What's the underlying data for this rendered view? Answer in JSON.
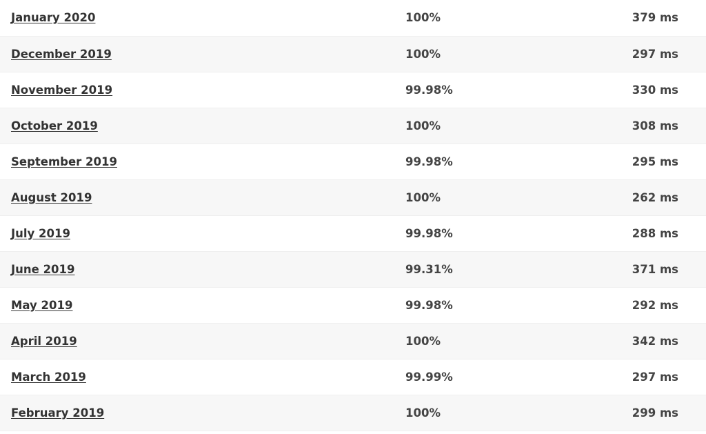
{
  "rows": [
    {
      "month": "January 2020",
      "uptime": "100%",
      "response": "379 ms"
    },
    {
      "month": "December 2019",
      "uptime": "100%",
      "response": "297 ms"
    },
    {
      "month": "November 2019",
      "uptime": "99.98%",
      "response": "330 ms"
    },
    {
      "month": "October 2019",
      "uptime": "100%",
      "response": "308 ms"
    },
    {
      "month": "September 2019",
      "uptime": "99.98%",
      "response": "295 ms"
    },
    {
      "month": "August 2019",
      "uptime": "100%",
      "response": "262 ms"
    },
    {
      "month": "July 2019",
      "uptime": "99.98%",
      "response": "288 ms"
    },
    {
      "month": "June 2019",
      "uptime": "99.31%",
      "response": "371 ms"
    },
    {
      "month": "May 2019",
      "uptime": "99.98%",
      "response": "292 ms"
    },
    {
      "month": "April 2019",
      "uptime": "100%",
      "response": "342 ms"
    },
    {
      "month": "March 2019",
      "uptime": "99.99%",
      "response": "297 ms"
    },
    {
      "month": "February 2019",
      "uptime": "100%",
      "response": "299 ms"
    }
  ]
}
